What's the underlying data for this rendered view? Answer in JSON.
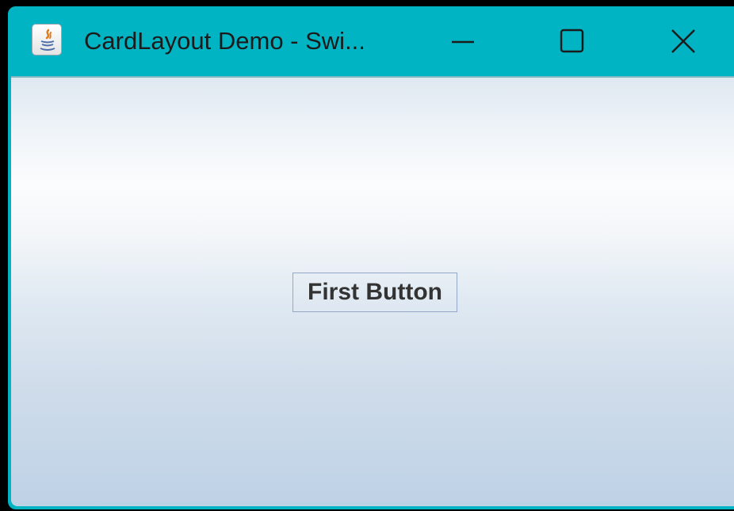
{
  "window": {
    "title": "CardLayout Demo - Swi...",
    "icon": "java-icon",
    "controls": {
      "minimize": "minimize-icon",
      "maximize": "maximize-icon",
      "close": "close-icon"
    },
    "accent_color": "#00b4c4"
  },
  "content": {
    "button_label": "First Button"
  }
}
